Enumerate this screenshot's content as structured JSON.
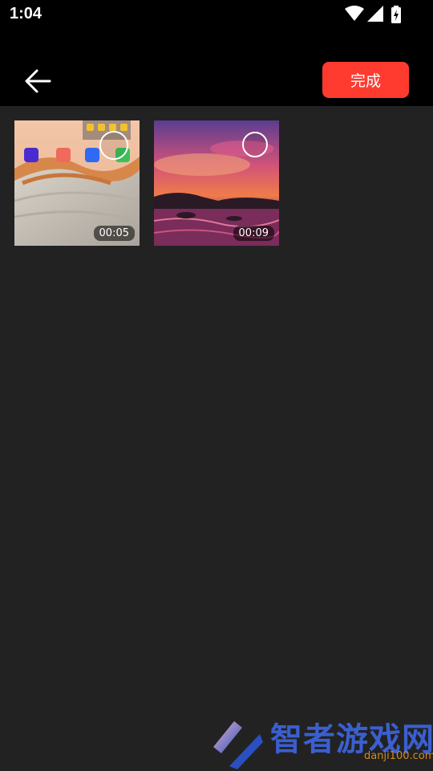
{
  "status_bar": {
    "time": "1:04",
    "icons": [
      "wifi-icon",
      "cellular-signal-icon",
      "battery-charging-icon"
    ]
  },
  "app_bar": {
    "back_icon": "arrow-left-icon",
    "done_label": "完成",
    "accent_color": "#ff3b30"
  },
  "media": [
    {
      "duration": "00:05",
      "selected": false
    },
    {
      "duration": "00:09",
      "selected": false
    }
  ],
  "watermark": {
    "title": "智者游戏网",
    "subtitle": "danji100.com"
  }
}
